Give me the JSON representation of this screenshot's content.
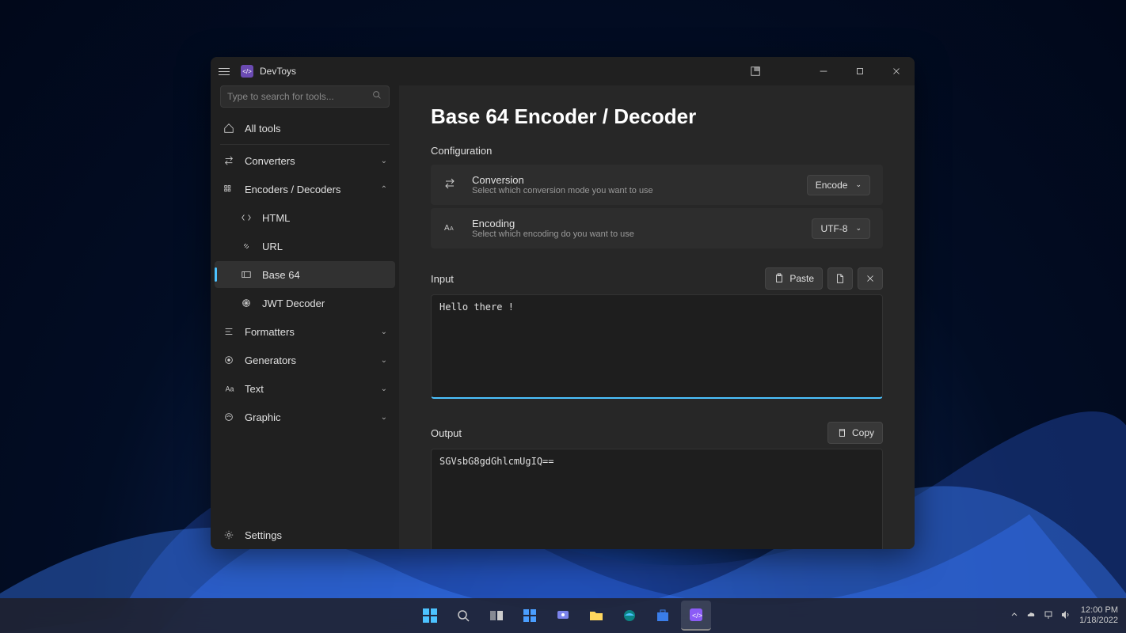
{
  "app": {
    "title": "DevToys"
  },
  "search": {
    "placeholder": "Type to search for tools..."
  },
  "sidebar": {
    "all_tools": "All tools",
    "converters": "Converters",
    "encoders": "Encoders / Decoders",
    "items": {
      "html": "HTML",
      "url": "URL",
      "base64": "Base 64",
      "jwt": "JWT Decoder"
    },
    "formatters": "Formatters",
    "generators": "Generators",
    "text": "Text",
    "graphic": "Graphic",
    "settings": "Settings"
  },
  "main": {
    "title": "Base 64 Encoder / Decoder",
    "config_label": "Configuration",
    "conversion": {
      "title": "Conversion",
      "desc": "Select which conversion mode you want to use",
      "value": "Encode"
    },
    "encoding": {
      "title": "Encoding",
      "desc": "Select which encoding do you want to use",
      "value": "UTF-8"
    },
    "input_label": "Input",
    "paste_label": "Paste",
    "input_value": "Hello there !",
    "output_label": "Output",
    "copy_label": "Copy",
    "output_value": "SGVsbG8gdGhlcmUgIQ=="
  },
  "taskbar": {
    "time": "12:00 PM",
    "date": "1/18/2022"
  }
}
